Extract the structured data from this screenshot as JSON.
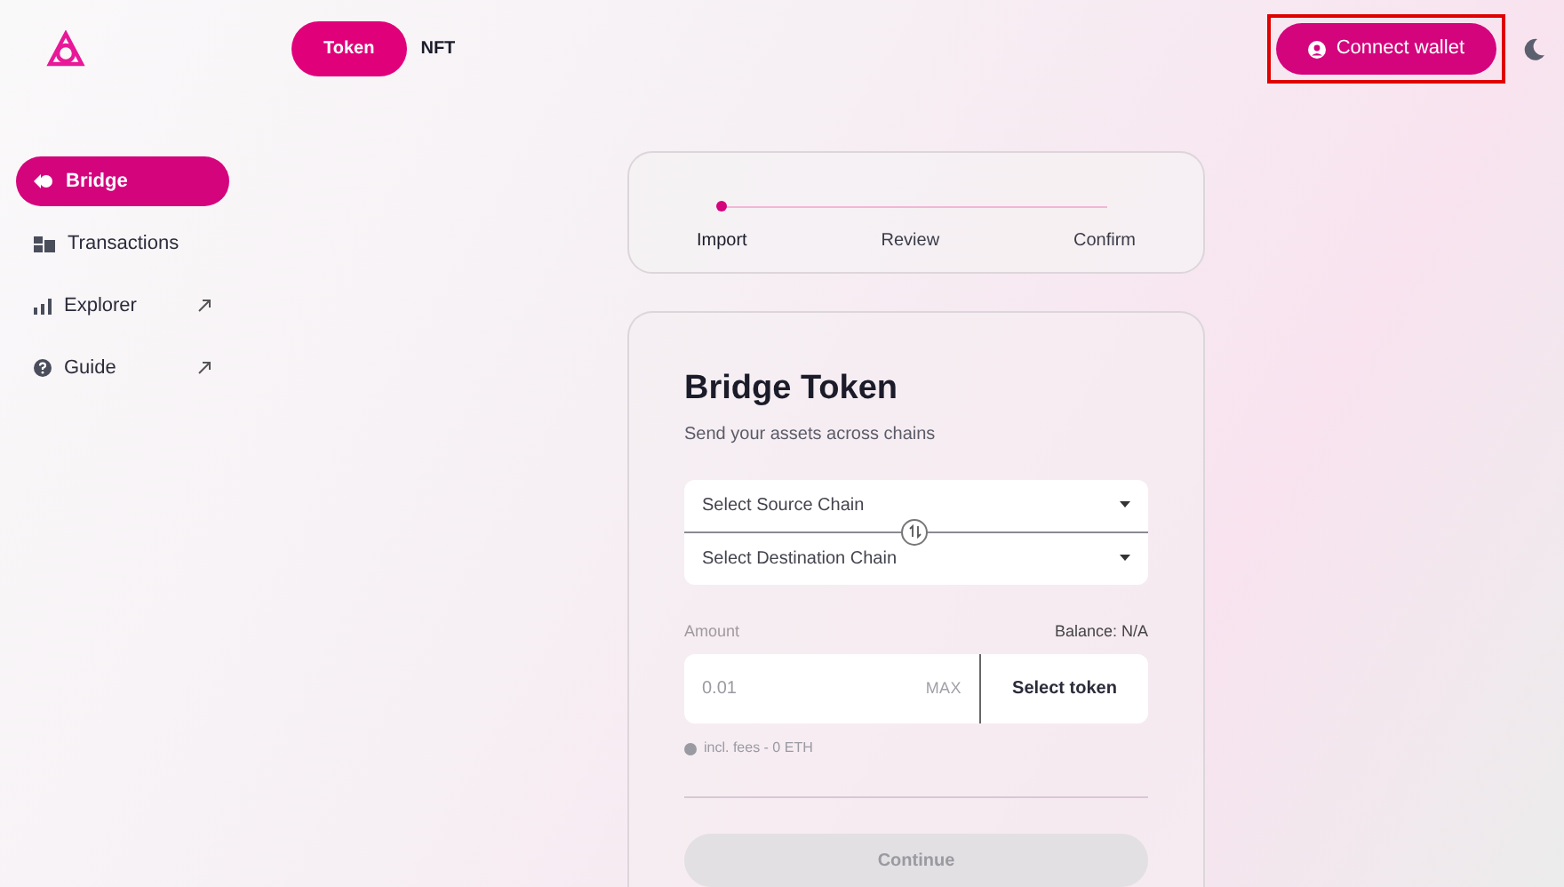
{
  "header": {
    "tabs": [
      {
        "label": "Token",
        "selected": true
      },
      {
        "label": "NFT",
        "selected": false
      }
    ],
    "connect_button": "Connect wallet",
    "connect_highlighted": true
  },
  "sidebar": {
    "items": [
      {
        "label": "Bridge",
        "selected": true,
        "external": false
      },
      {
        "label": "Transactions",
        "selected": false,
        "external": false
      },
      {
        "label": "Explorer",
        "selected": false,
        "external": true
      },
      {
        "label": "Guide",
        "selected": false,
        "external": true
      }
    ]
  },
  "stepper": {
    "steps": [
      {
        "label": "Import",
        "selected": true
      },
      {
        "label": "Review",
        "selected": false
      },
      {
        "label": "Confirm",
        "selected": false
      }
    ]
  },
  "bridge_card": {
    "title": "Bridge Token",
    "subtitle": "Send your assets across chains",
    "source_chain": "Select Source Chain",
    "destination_chain": "Select Destination Chain",
    "amount_label": "Amount",
    "balance": "Balance: N/A",
    "amount_placeholder": "0.01",
    "max_button": "MAX",
    "token_button": "Select token",
    "fees": "incl. fees - 0 ETH",
    "continue_button": {
      "label": "Continue",
      "disabled": true
    }
  }
}
